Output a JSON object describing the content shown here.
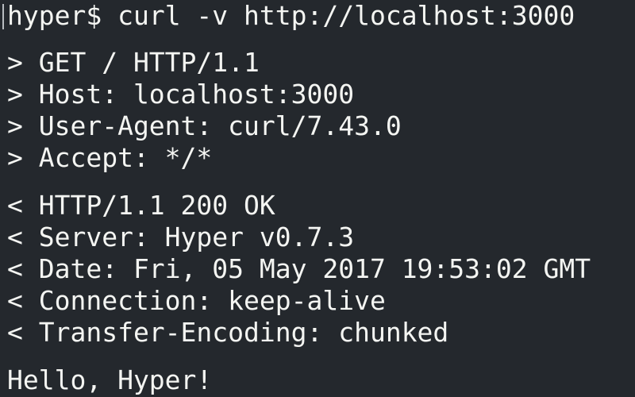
{
  "terminal": {
    "prompt": "hyper$",
    "command": "curl -v http://localhost:3000",
    "request": [
      "> GET / HTTP/1.1",
      "> Host: localhost:3000",
      "> User-Agent: curl/7.43.0",
      "> Accept: */*"
    ],
    "response": [
      "< HTTP/1.1 200 OK",
      "< Server: Hyper v0.7.3",
      "< Date: Fri, 05 May 2017 19:53:02 GMT",
      "< Connection: keep-alive",
      "< Transfer-Encoding: chunked"
    ],
    "body": "Hello, Hyper!"
  },
  "colors": {
    "background": "#24282d",
    "foreground": "#f4f5f2",
    "cursor": "#b8bcc0"
  }
}
